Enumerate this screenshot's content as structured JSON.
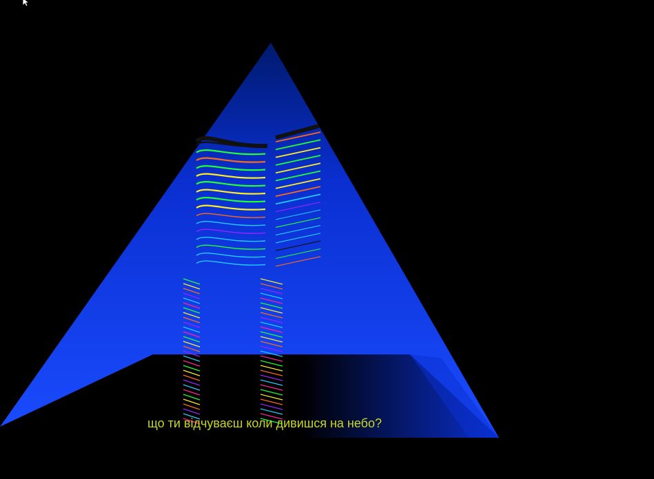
{
  "subtitle": "що ти відчуваєш коли дивишся на небо?",
  "colors": {
    "background": "#000000",
    "pyramid_dark": "#001a6e",
    "pyramid_mid": "#0a2fd0",
    "pyramid_light": "#1a4cff",
    "subtitle": "#c8d820",
    "stripe_palette": [
      "#22ff33",
      "#ffee22",
      "#ff6a1a",
      "#9a22ff",
      "#22ccff",
      "#ff2299",
      "#111111"
    ]
  },
  "icons": {
    "cursor": "arrow-cursor-icon"
  }
}
